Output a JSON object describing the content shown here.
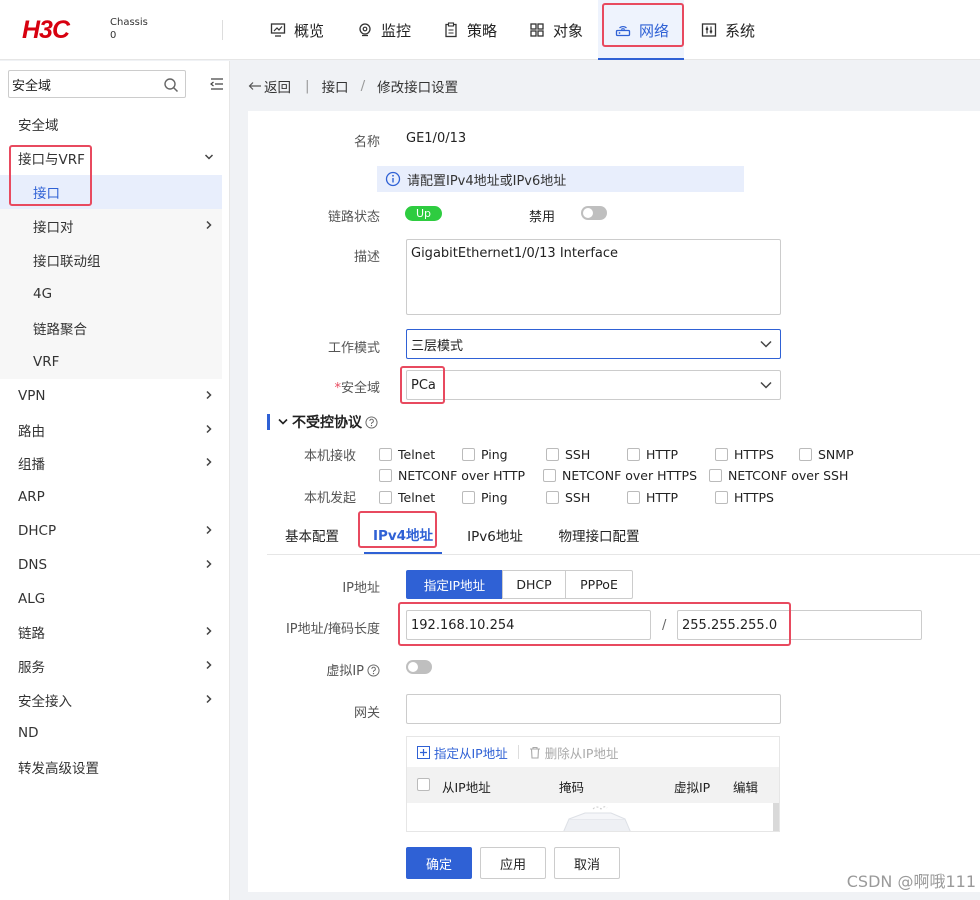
{
  "header": {
    "logo": "H3C",
    "chassis_label": "Chassis",
    "chassis_value": "0",
    "nav": [
      {
        "label": "概览",
        "icon": "monitor-chart-icon"
      },
      {
        "label": "监控",
        "icon": "location-pin-icon"
      },
      {
        "label": "策略",
        "icon": "clipboard-icon"
      },
      {
        "label": "对象",
        "icon": "grid-icon"
      },
      {
        "label": "网络",
        "icon": "router-icon",
        "active": true
      },
      {
        "label": "系统",
        "icon": "settings-panel-icon"
      }
    ]
  },
  "sidebar": {
    "search_value": "安全域",
    "items": [
      {
        "label": "安全域",
        "level": 1
      },
      {
        "label": "接口与VRF",
        "level": 1,
        "expanded": true
      },
      {
        "label": "接口",
        "level": 2,
        "active": true
      },
      {
        "label": "接口对",
        "level": 2,
        "has_children": true
      },
      {
        "label": "接口联动组",
        "level": 2
      },
      {
        "label": "4G",
        "level": 2
      },
      {
        "label": "链路聚合",
        "level": 2
      },
      {
        "label": "VRF",
        "level": 2
      },
      {
        "label": "VPN",
        "level": 1,
        "has_children": true
      },
      {
        "label": "路由",
        "level": 1,
        "has_children": true
      },
      {
        "label": "组播",
        "level": 1,
        "has_children": true
      },
      {
        "label": "ARP",
        "level": 1
      },
      {
        "label": "DHCP",
        "level": 1,
        "has_children": true
      },
      {
        "label": "DNS",
        "level": 1,
        "has_children": true
      },
      {
        "label": "ALG",
        "level": 1
      },
      {
        "label": "链路",
        "level": 1,
        "has_children": true
      },
      {
        "label": "服务",
        "level": 1,
        "has_children": true
      },
      {
        "label": "安全接入",
        "level": 1,
        "has_children": true
      },
      {
        "label": "ND",
        "level": 1
      },
      {
        "label": "转发高级设置",
        "level": 1
      }
    ]
  },
  "breadcrumb": {
    "back": "返回",
    "sep1": "|",
    "level1": "接口",
    "sep2": "/",
    "level2": "修改接口设置"
  },
  "form": {
    "name_label": "名称",
    "name_value": "GE1/0/13",
    "info_message": "请配置IPv4地址或IPv6地址",
    "link_status_label": "链路状态",
    "link_status_value": "Up",
    "disable_label": "禁用",
    "description_label": "描述",
    "description_value": "GigabitEthernet1/0/13 Interface",
    "work_mode_label": "工作模式",
    "work_mode_value": "三层模式",
    "security_zone_required": "*",
    "security_zone_label": "安全域",
    "security_zone_value": "PCa"
  },
  "protocols": {
    "title": "不受控协议",
    "receive_label": "本机接收",
    "initiate_label": "本机发起",
    "receive_row1": [
      "Telnet",
      "Ping",
      "SSH",
      "HTTP",
      "HTTPS",
      "SNMP"
    ],
    "receive_row2": [
      "NETCONF over HTTP",
      "NETCONF over HTTPS",
      "NETCONF over SSH"
    ],
    "initiate_row": [
      "Telnet",
      "Ping",
      "SSH",
      "HTTP",
      "HTTPS"
    ]
  },
  "tabs": [
    "基本配置",
    "IPv4地址",
    "IPv6地址",
    "物理接口配置"
  ],
  "ipv4": {
    "ip_label": "IP地址",
    "modes": [
      "指定IP地址",
      "DHCP",
      "PPPoE"
    ],
    "addr_mask_label": "IP地址/掩码长度",
    "ip_value": "192.168.10.254",
    "slash": "/",
    "mask_value": "255.255.255.0",
    "virtual_ip_label": "虚拟IP",
    "gateway_label": "网关",
    "gateway_value": "",
    "add_secondary": "指定从IP地址",
    "delete_secondary": "删除从IP地址",
    "columns": [
      "从IP地址",
      "掩码",
      "虚拟IP",
      "编辑"
    ]
  },
  "actions": {
    "ok": "确定",
    "apply": "应用",
    "cancel": "取消"
  },
  "watermark": "CSDN @啊哦111",
  "colors": {
    "accent": "#2f61d5",
    "brand_red": "#d7000f",
    "up_green": "#2ecc40",
    "highlight_box": "#e84a5f"
  }
}
